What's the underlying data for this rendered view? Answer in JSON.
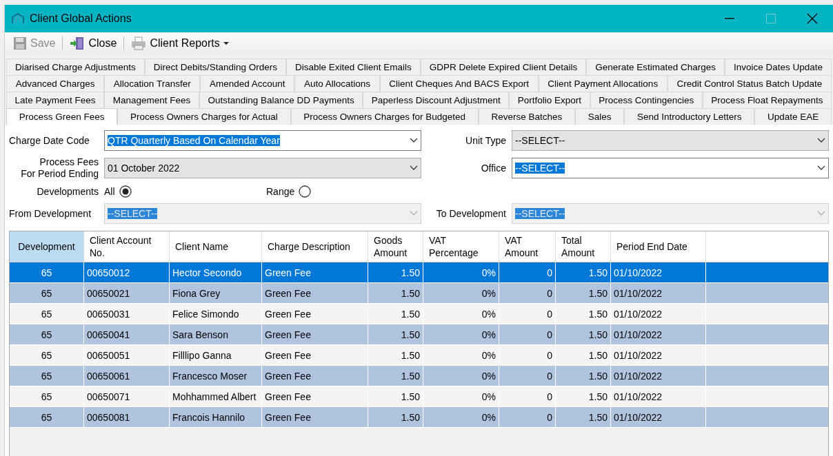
{
  "window": {
    "title": "Client Global Actions"
  },
  "toolbar": [
    {
      "kind": "save",
      "label": "Save",
      "disabled": true
    },
    {
      "kind": "close",
      "label": "Close",
      "disabled": false
    },
    {
      "kind": "reports",
      "label": "Client Reports",
      "disabled": false
    }
  ],
  "tab_rows": [
    [
      {
        "label": "Diarised Charge Adjustments",
        "selected": false
      },
      {
        "label": "Direct Debits/Standing Orders",
        "selected": false
      },
      {
        "label": "Disable Exited Client Emails",
        "selected": false
      },
      {
        "label": "GDPR Delete Expired Client Details",
        "selected": false
      },
      {
        "label": "Generate Estimated Charges",
        "selected": false
      },
      {
        "label": "Invoice Dates Update",
        "selected": false
      }
    ],
    [
      {
        "label": "Advanced Charges",
        "selected": false
      },
      {
        "label": "Allocation Transfer",
        "selected": false
      },
      {
        "label": "Amended Account",
        "selected": false
      },
      {
        "label": "Auto Allocations",
        "selected": false
      },
      {
        "label": "Client Cheques And BACS Export",
        "selected": false
      },
      {
        "label": "Client Payment Allocations",
        "selected": false
      },
      {
        "label": "Credit Control Status Batch Update",
        "selected": false
      }
    ],
    [
      {
        "label": "Late Payment Fees",
        "selected": false
      },
      {
        "label": "Management Fees",
        "selected": false
      },
      {
        "label": "Outstanding Balance DD Payments",
        "selected": false
      },
      {
        "label": "Paperless Discount Adjustment",
        "selected": false
      },
      {
        "label": "Portfolio Export",
        "selected": false
      },
      {
        "label": "Process Contingencies",
        "selected": false
      },
      {
        "label": "Process Float Repayments",
        "selected": false
      }
    ],
    [
      {
        "label": "Process Green Fees",
        "selected": true
      },
      {
        "label": "Process Owners Charges for Actual",
        "selected": false
      },
      {
        "label": "Process Owners Charges for Budgeted",
        "selected": false
      },
      {
        "label": "Reverse  Batches",
        "selected": false
      },
      {
        "label": "Sales",
        "selected": false
      },
      {
        "label": "Send Introductory Letters",
        "selected": false
      },
      {
        "label": "Update EAE",
        "selected": false
      }
    ]
  ],
  "form": {
    "charge_date_code": {
      "label": "Charge Date Code",
      "value": "QTR  Quarterly Based On Calendar Year",
      "disabled": false,
      "highlighted": true
    },
    "unit_type": {
      "label": "Unit Type",
      "value": "--SELECT--",
      "disabled": true,
      "highlighted": false
    },
    "period_ending": {
      "label_lines": [
        "Process Fees",
        "For Period Ending"
      ],
      "value": "01 October 2022",
      "disabled": true,
      "highlighted": false
    },
    "office": {
      "label": "Office",
      "value": "--SELECT--",
      "disabled": false,
      "highlighted": true
    },
    "developments": {
      "label": "Developments",
      "options": [
        {
          "label": "All",
          "selected": true
        },
        {
          "label": "Range",
          "selected": false
        }
      ]
    },
    "from_development": {
      "label": "From Development",
      "value": "--SELECT--",
      "disabled": true,
      "highlighted": true
    },
    "to_development": {
      "label": "To Development",
      "value": "--SELECT--",
      "disabled": true,
      "highlighted": true
    }
  },
  "table": {
    "columns": [
      {
        "label": "Development"
      },
      {
        "label": "Client Account No."
      },
      {
        "label": "Client Name"
      },
      {
        "label": "Charge Description"
      },
      {
        "label": "Goods Amount"
      },
      {
        "label": "VAT Percentage"
      },
      {
        "label": "VAT Amount"
      },
      {
        "label": "Total Amount"
      },
      {
        "label": "Period End Date"
      }
    ],
    "rows": [
      {
        "selected": true,
        "cells": [
          "65",
          "00650012",
          "Hector Secondo",
          "Green Fee",
          "1.50",
          "0%",
          "0",
          "1.50",
          "01/10/2022"
        ]
      },
      {
        "selected": false,
        "cells": [
          "65",
          "00650021",
          "Fiona Grey",
          "Green Fee",
          "1.50",
          "0%",
          "0",
          "1.50",
          "01/10/2022"
        ]
      },
      {
        "selected": false,
        "cells": [
          "65",
          "00650031",
          "Felice Simondo",
          "Green Fee",
          "1.50",
          "0%",
          "0",
          "1.50",
          "01/10/2022"
        ]
      },
      {
        "selected": false,
        "cells": [
          "65",
          "00650041",
          "Sara Benson",
          "Green Fee",
          "1.50",
          "0%",
          "0",
          "1.50",
          "01/10/2022"
        ]
      },
      {
        "selected": false,
        "cells": [
          "65",
          "00650051",
          "Filllipo Ganna",
          "Green Fee",
          "1.50",
          "0%",
          "0",
          "1.50",
          "01/10/2022"
        ]
      },
      {
        "selected": false,
        "cells": [
          "65",
          "00650061",
          "Francesco Moser",
          "Green Fee",
          "1.50",
          "0%",
          "0",
          "1.50",
          "01/10/2022"
        ]
      },
      {
        "selected": false,
        "cells": [
          "65",
          "00650071",
          "Mohhammed Albert",
          "Green Fee",
          "1.50",
          "0%",
          "0",
          "1.50",
          "01/10/2022"
        ]
      },
      {
        "selected": false,
        "cells": [
          "65",
          "00650081",
          "Francois Hannilo",
          "Green Fee",
          "1.50",
          "0%",
          "0",
          "1.50",
          "01/10/2022"
        ]
      }
    ]
  }
}
